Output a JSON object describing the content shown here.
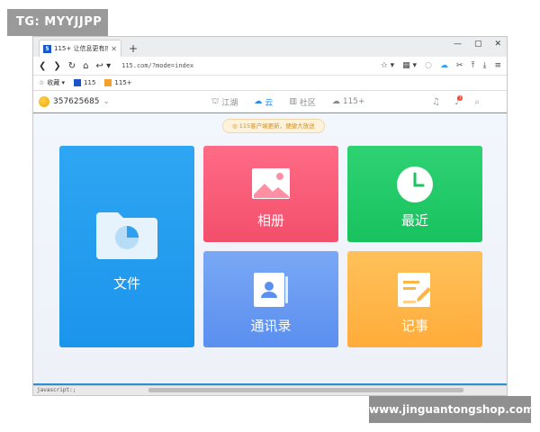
{
  "overlay": {
    "tag": "TG: MYYJJPP",
    "watermark": "www.jinguantongshop.com"
  },
  "browser": {
    "tab_title": "115+ 让信息更有序",
    "tab_icon": "5",
    "new_tab": "+",
    "url": "115.com/?mode=index",
    "window_controls": [
      "—",
      "▢",
      "✕"
    ],
    "bookmarks": [
      {
        "label": "收藏 ▾",
        "icon": "star-icon"
      },
      {
        "label": "115",
        "icon": "app-115-icon"
      },
      {
        "label": "115+",
        "icon": "app-115plus-icon"
      }
    ],
    "status_text": "javascript:;"
  },
  "app": {
    "user_id": "357625685",
    "nav": [
      {
        "label": "江湖",
        "icon": "jianghu-icon",
        "active": false
      },
      {
        "label": "云",
        "icon": "cloud-icon",
        "active": true
      },
      {
        "label": "社区",
        "icon": "community-icon",
        "active": false
      },
      {
        "label": "115+",
        "icon": "115plus-cloud-icon",
        "active": false
      }
    ],
    "notification_count": "1",
    "notice": "115客户端更新，便捷大放送",
    "tiles": [
      {
        "id": "files",
        "label": "文件",
        "color": "#1e97ee"
      },
      {
        "id": "album",
        "label": "相册",
        "color": "#f6566f"
      },
      {
        "id": "recent",
        "label": "最近",
        "color": "#1fc765"
      },
      {
        "id": "contacts",
        "label": "通讯录",
        "color": "#6898f2"
      },
      {
        "id": "notes",
        "label": "记事",
        "color": "#ffb446"
      }
    ]
  },
  "colors": {
    "accent": "#36a4ee",
    "badge": "#f24b3a"
  }
}
